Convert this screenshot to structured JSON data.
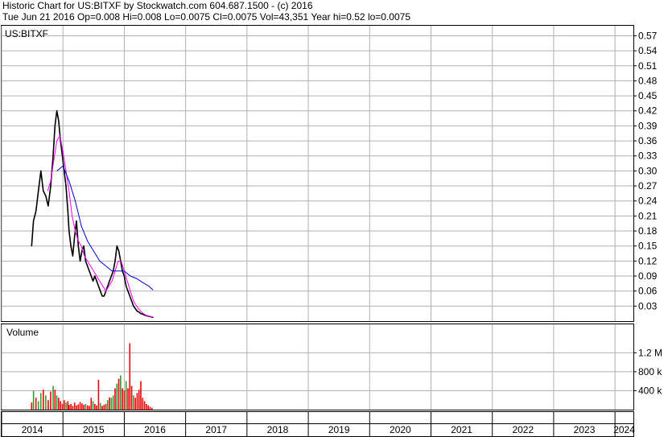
{
  "header": {
    "line1": "Historic Chart for US:BITXF by Stockwatch.com 604.687.1500 - (c) 2016",
    "line2": "Tue Jun 21 2016   Op=0.008   Hi=0.008   Lo=0.0075   Cl=0.0075   Vol=43,351   Year hi=0.52   lo=0.0075"
  },
  "colors": {
    "price": "#000000",
    "ma_short": "#ff00ff",
    "ma_long": "#0000cc",
    "marker": "#cc0000",
    "vol_up": "#339933",
    "vol_down": "#ee0000",
    "grid": "#b0b0b0"
  },
  "chart_data": [
    {
      "type": "line",
      "symbol_label": "US:BITXF",
      "ylim": [
        0,
        0.59
      ],
      "y_ticks": [
        0.03,
        0.06,
        0.09,
        0.12,
        0.15,
        0.18,
        0.21,
        0.24,
        0.27,
        0.3,
        0.33,
        0.36,
        0.39,
        0.42,
        0.45,
        0.48,
        0.51,
        0.54,
        0.57
      ],
      "xlim": [
        2014.0,
        2024.3
      ],
      "x_ticks": [
        "2014",
        "2015",
        "2016",
        "2017",
        "2018",
        "2019",
        "2020",
        "2021",
        "2022",
        "2023",
        "2024"
      ],
      "series": [
        {
          "key": "price",
          "x": [
            2014.49,
            2014.52,
            2014.56,
            2014.6,
            2014.64,
            2014.68,
            2014.72,
            2014.76,
            2014.8,
            2014.84,
            2014.87,
            2014.9,
            2014.93,
            2014.96,
            2014.99,
            2015.02,
            2015.05,
            2015.08,
            2015.1,
            2015.13,
            2015.16,
            2015.19,
            2015.22,
            2015.25,
            2015.28,
            2015.31,
            2015.34,
            2015.37,
            2015.4,
            2015.43,
            2015.46,
            2015.49,
            2015.52,
            2015.55,
            2015.58,
            2015.61,
            2015.64,
            2015.67,
            2015.7,
            2015.73,
            2015.76,
            2015.79,
            2015.82,
            2015.85,
            2015.88,
            2015.91,
            2015.94,
            2015.97,
            2016.0,
            2016.03,
            2016.06,
            2016.09,
            2016.12,
            2016.15,
            2016.18,
            2016.21,
            2016.24,
            2016.27,
            2016.3,
            2016.33,
            2016.36,
            2016.39,
            2016.42,
            2016.45,
            2016.47
          ],
          "y": [
            0.15,
            0.2,
            0.22,
            0.26,
            0.3,
            0.26,
            0.25,
            0.23,
            0.27,
            0.33,
            0.39,
            0.42,
            0.4,
            0.36,
            0.33,
            0.3,
            0.27,
            0.22,
            0.18,
            0.15,
            0.13,
            0.17,
            0.2,
            0.15,
            0.12,
            0.14,
            0.15,
            0.12,
            0.11,
            0.1,
            0.09,
            0.08,
            0.09,
            0.08,
            0.07,
            0.06,
            0.05,
            0.05,
            0.06,
            0.07,
            0.08,
            0.09,
            0.1,
            0.12,
            0.15,
            0.14,
            0.12,
            0.1,
            0.09,
            0.07,
            0.06,
            0.05,
            0.04,
            0.03,
            0.025,
            0.02,
            0.018,
            0.015,
            0.014,
            0.012,
            0.011,
            0.01,
            0.009,
            0.008,
            0.0075
          ]
        },
        {
          "key": "ma_short",
          "x": [
            2014.75,
            2014.8,
            2014.85,
            2014.9,
            2014.95,
            2015.0,
            2015.05,
            2015.1,
            2015.15,
            2015.2,
            2015.25,
            2015.3,
            2015.35,
            2015.4,
            2015.45,
            2015.5,
            2015.55,
            2015.6,
            2015.65,
            2015.7,
            2015.75,
            2015.8,
            2015.85,
            2015.9,
            2015.95,
            2016.0,
            2016.05,
            2016.1,
            2016.15,
            2016.2,
            2016.25,
            2016.3,
            2016.35,
            2016.4,
            2016.47
          ],
          "y": [
            0.26,
            0.28,
            0.32,
            0.36,
            0.37,
            0.34,
            0.3,
            0.26,
            0.21,
            0.18,
            0.16,
            0.15,
            0.13,
            0.12,
            0.11,
            0.1,
            0.09,
            0.08,
            0.07,
            0.06,
            0.07,
            0.08,
            0.1,
            0.12,
            0.12,
            0.1,
            0.08,
            0.06,
            0.04,
            0.03,
            0.022,
            0.016,
            0.012,
            0.01,
            0.008
          ]
        },
        {
          "key": "ma_long",
          "x": [
            2014.9,
            2015.0,
            2015.1,
            2015.2,
            2015.3,
            2015.4,
            2015.5,
            2015.6,
            2015.7,
            2015.8,
            2015.9,
            2016.0,
            2016.1,
            2016.2,
            2016.3,
            2016.4,
            2016.47
          ],
          "y": [
            0.3,
            0.31,
            0.28,
            0.24,
            0.19,
            0.16,
            0.14,
            0.12,
            0.11,
            0.1,
            0.1,
            0.1,
            0.09,
            0.085,
            0.077,
            0.07,
            0.062
          ]
        }
      ]
    },
    {
      "type": "bar",
      "label": "Volume",
      "ylim": [
        0,
        1800000
      ],
      "y_ticks": [
        400000,
        800000,
        1200000
      ],
      "y_tick_labels": [
        "400 k",
        "800 k",
        "1.2 M"
      ],
      "x": [
        2014.49,
        2014.52,
        2014.56,
        2014.6,
        2014.64,
        2014.68,
        2014.72,
        2014.76,
        2014.8,
        2014.84,
        2014.87,
        2014.9,
        2014.93,
        2014.96,
        2014.99,
        2015.02,
        2015.05,
        2015.08,
        2015.1,
        2015.13,
        2015.16,
        2015.19,
        2015.22,
        2015.25,
        2015.28,
        2015.31,
        2015.34,
        2015.37,
        2015.4,
        2015.43,
        2015.46,
        2015.49,
        2015.52,
        2015.55,
        2015.58,
        2015.61,
        2015.64,
        2015.67,
        2015.7,
        2015.73,
        2015.76,
        2015.79,
        2015.82,
        2015.85,
        2015.88,
        2015.91,
        2015.94,
        2015.97,
        2016.0,
        2016.03,
        2016.06,
        2016.09,
        2016.12,
        2016.15,
        2016.18,
        2016.21,
        2016.24,
        2016.27,
        2016.3,
        2016.33,
        2016.36,
        2016.39,
        2016.42,
        2016.45
      ],
      "values": [
        150000,
        400000,
        250000,
        180000,
        350000,
        420000,
        300000,
        200000,
        380000,
        500000,
        420000,
        300000,
        250000,
        180000,
        120000,
        200000,
        150000,
        180000,
        100000,
        120000,
        80000,
        150000,
        90000,
        110000,
        160000,
        130000,
        100000,
        120000,
        90000,
        80000,
        250000,
        180000,
        120000,
        90000,
        630000,
        140000,
        80000,
        100000,
        120000,
        200000,
        260000,
        250000,
        300000,
        450000,
        550000,
        650000,
        720000,
        450000,
        400000,
        600000,
        450000,
        1400000,
        500000,
        300000,
        250000,
        350000,
        420000,
        600000,
        250000,
        180000,
        120000,
        90000,
        60000,
        40000
      ],
      "colors": [
        "down",
        "up",
        "down",
        "up",
        "up",
        "down",
        "up",
        "down",
        "down",
        "up",
        "down",
        "up",
        "down",
        "down",
        "down",
        "down",
        "up",
        "down",
        "down",
        "down",
        "down",
        "down",
        "down",
        "down",
        "down",
        "down",
        "down",
        "up",
        "down",
        "down",
        "down",
        "up",
        "down",
        "down",
        "down",
        "up",
        "down",
        "down",
        "down",
        "up",
        "down",
        "up",
        "up",
        "down",
        "up",
        "down",
        "up",
        "down",
        "down",
        "up",
        "down",
        "down",
        "down",
        "up",
        "down",
        "down",
        "down",
        "down",
        "down",
        "down",
        "down",
        "down",
        "down",
        "down"
      ]
    }
  ]
}
